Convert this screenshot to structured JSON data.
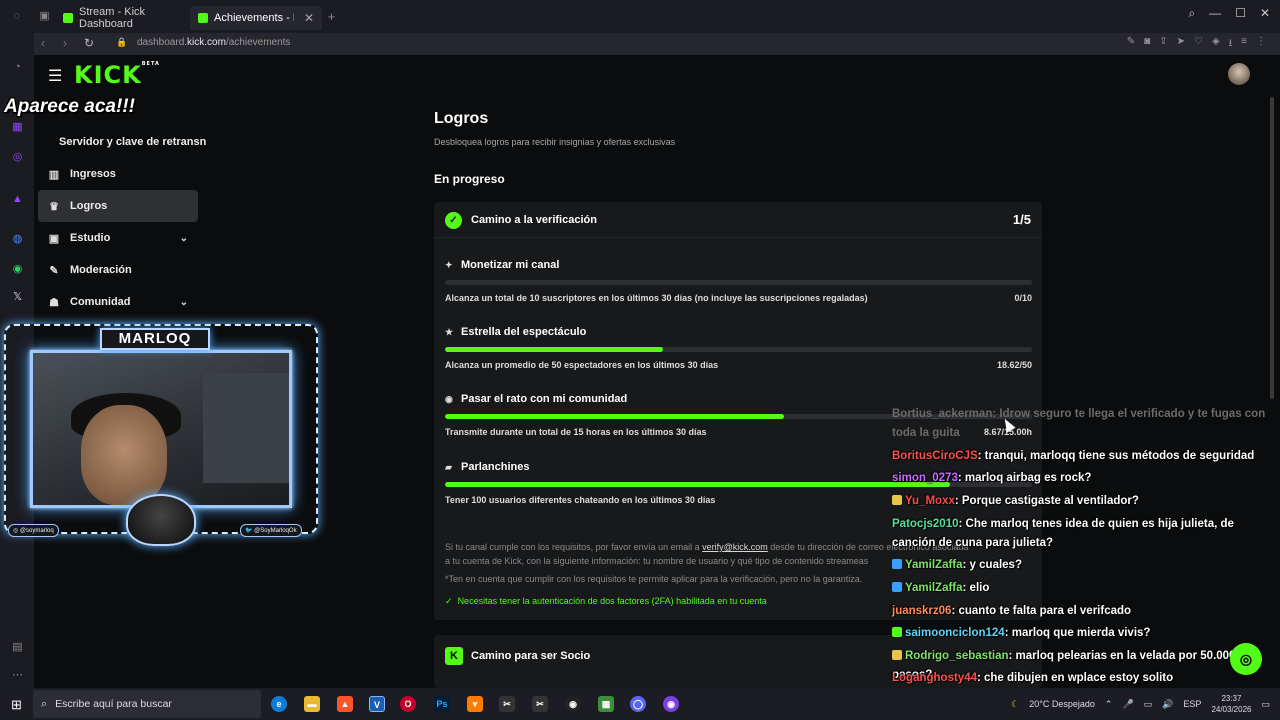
{
  "browser": {
    "tabs": [
      {
        "label": "Stream - Kick Dashboard"
      },
      {
        "label": "Achievements - Kick Dashb"
      }
    ],
    "url_prefix": "dashboard.",
    "url_domain": "kick.com",
    "url_path": "/achievements"
  },
  "app": {
    "logo": "KICK",
    "logo_sup": "BETA"
  },
  "overlay_caption": "Aparece aca!!!",
  "sidebar": {
    "header": "Servidor y clave de retransn",
    "items": [
      {
        "label": "Ingresos",
        "icon": "bar-chart-icon"
      },
      {
        "label": "Logros",
        "icon": "trophy-icon",
        "active": true
      },
      {
        "label": "Estudio",
        "icon": "studio-icon",
        "chevron": true
      },
      {
        "label": "Moderación",
        "icon": "wrench-icon"
      },
      {
        "label": "Comunidad",
        "icon": "users-icon",
        "chevron": true
      }
    ]
  },
  "page": {
    "title": "Logros",
    "subtitle": "Desbloquea logros para recibir insignias y ofertas exclusivas",
    "section": "En progreso"
  },
  "verification": {
    "title": "Camino a la verificación",
    "count": "1/5",
    "goals": [
      {
        "title": "Monetizar mi canal",
        "desc": "Alcanza un total de 10 suscriptores en los últimos 30 días (no incluye las suscripciones regaladas)",
        "value": "0/10",
        "progress": 0.0
      },
      {
        "title": "Estrella del espectáculo",
        "desc": "Alcanza un promedio de 50 espectadores en los últimos 30 días",
        "value": "18.62/50",
        "progress": 0.372
      },
      {
        "title": "Pasar el rato con mi comunidad",
        "desc": "Transmite durante un total de 15 horas en los últimos 30 días",
        "value": "8.67/15.00h",
        "progress": 0.578
      },
      {
        "title": "Parlanchines",
        "desc": "Tener 100 usuarios diferentes chateando en los últimos 30 días",
        "value": "",
        "progress": 0.86
      }
    ],
    "note1_a": "Si tu canal cumple con los requisitos, por favor envía un email a ",
    "note1_link": "verify@kick.com",
    "note1_b": " desde tu dirección de correo electrónico asociada",
    "note2": "a tu cuenta de Kick, con la siguiente información: tu nombre de usuario y qué tipo de contenido streameas",
    "note3": "*Ten en cuenta que cumplir con los requisitos te permite aplicar para la verificación, pero no la garantiza.",
    "twofa": "Necesitas tener la autenticación de dos factores (2FA) habilitada en tu cuenta"
  },
  "partner": {
    "title": "Camino para ser Socio"
  },
  "webcam": {
    "name": "MARLOQ",
    "ig": "@soymarloq",
    "tw": "@SoyMarloqOk"
  },
  "chat": [
    {
      "user": "Bortius_ackerman",
      "msg": ": Idrow seguro te llega el verificado y te fugas con toda la guita",
      "color": "#6b6b6b",
      "faded": true
    },
    {
      "user": "BoritusCiroCJS",
      "msg": ": tranqui, marloqq tiene sus métodos de seguridad",
      "color": "#ff4f4f"
    },
    {
      "user": "simon_0273",
      "msg": ": marloq airbag es rock?",
      "color": "#c66bff"
    },
    {
      "user": "Yu_Moxx",
      "msg": ": Porque castigaste al ventilador?",
      "color": "#ff4a4a",
      "icon": "#e7c54a"
    },
    {
      "user": "Patocjs2010",
      "msg": ": Che marloq tenes idea de quien es hija julieta, de canción de cuna para julieta?",
      "color": "#55e0a0"
    },
    {
      "user": "YamilZaffa",
      "msg": ": y cuales?",
      "color": "#7fe36a",
      "icon": "#3aa0ff"
    },
    {
      "user": "YamilZaffa",
      "msg": ": elio",
      "color": "#7fe36a",
      "icon": "#3aa0ff"
    },
    {
      "user": "juanskrz06",
      "msg": ": cuanto te falta para el verifcado",
      "color": "#ff8c5a"
    },
    {
      "user": "saimoonciclon124",
      "msg": ": marloq que mierda vivis?",
      "color": "#5ad6ff",
      "icon": "#53fc18"
    },
    {
      "user": "Rodrigo_sebastian",
      "msg": ": marloq pelearias en la velada por 50.000 pesos?",
      "color": "#7fe36a",
      "icon": "#e7c54a"
    },
    {
      "user": "Loganghosty44",
      "msg": ": che dibujen en wplace estoy solito",
      "color": "#ff4f4f"
    }
  ],
  "taskbar": {
    "search_placeholder": "Escribe aquí para buscar",
    "weather": "20°C  Despejado",
    "lang": "ESP",
    "time": "23:37",
    "date": "24/03/2026"
  }
}
